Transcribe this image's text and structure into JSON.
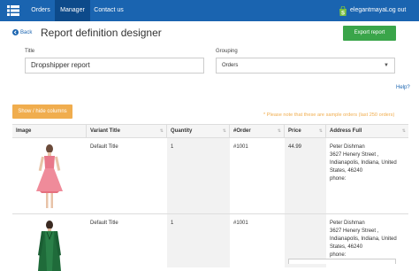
{
  "nav": {
    "items": [
      {
        "label": "Orders"
      },
      {
        "label": "Manager"
      },
      {
        "label": "Contact us"
      }
    ],
    "brand": "elegantmaya",
    "logout": "Log out"
  },
  "header": {
    "back": "Back",
    "title": "Report definition designer",
    "export": "Export report"
  },
  "form": {
    "title_label": "Title",
    "title_value": "Dropshipper report",
    "grouping_label": "Grouping",
    "grouping_value": "Orders",
    "help": "Help?"
  },
  "toolbar": {
    "columns_btn": "Show / hide columns",
    "notice": "* Please note that these are sample orders (last 250 orders)"
  },
  "table": {
    "columns": [
      "Image",
      "Variant Title",
      "Quantity",
      "#Order",
      "Price",
      "Address Full"
    ],
    "rows": [
      {
        "variant": "Default Title",
        "quantity": "1",
        "order": "#1001",
        "price": "44.99",
        "addr1": "Peter Dishman",
        "addr2": "3627 Henery Street ,",
        "addr3": "Indianapolis, Indiana, United",
        "addr4": "States, 46240",
        "addr5": "phone:",
        "image": "pink-dress-photo"
      },
      {
        "variant": "Default Title",
        "quantity": "1",
        "order": "#1001",
        "price": "",
        "addr1": "Peter Dishman",
        "addr2": "3627 Henery Street ,",
        "addr3": "Indianapolis, Indiana, United",
        "addr4": "States, 46240",
        "addr5": "phone:",
        "image": "green-coat-photo"
      }
    ]
  },
  "colors": {
    "nav_bg": "#1a64b0",
    "export_bg": "#3aa54a",
    "columns_bg": "#f0ad4e"
  }
}
